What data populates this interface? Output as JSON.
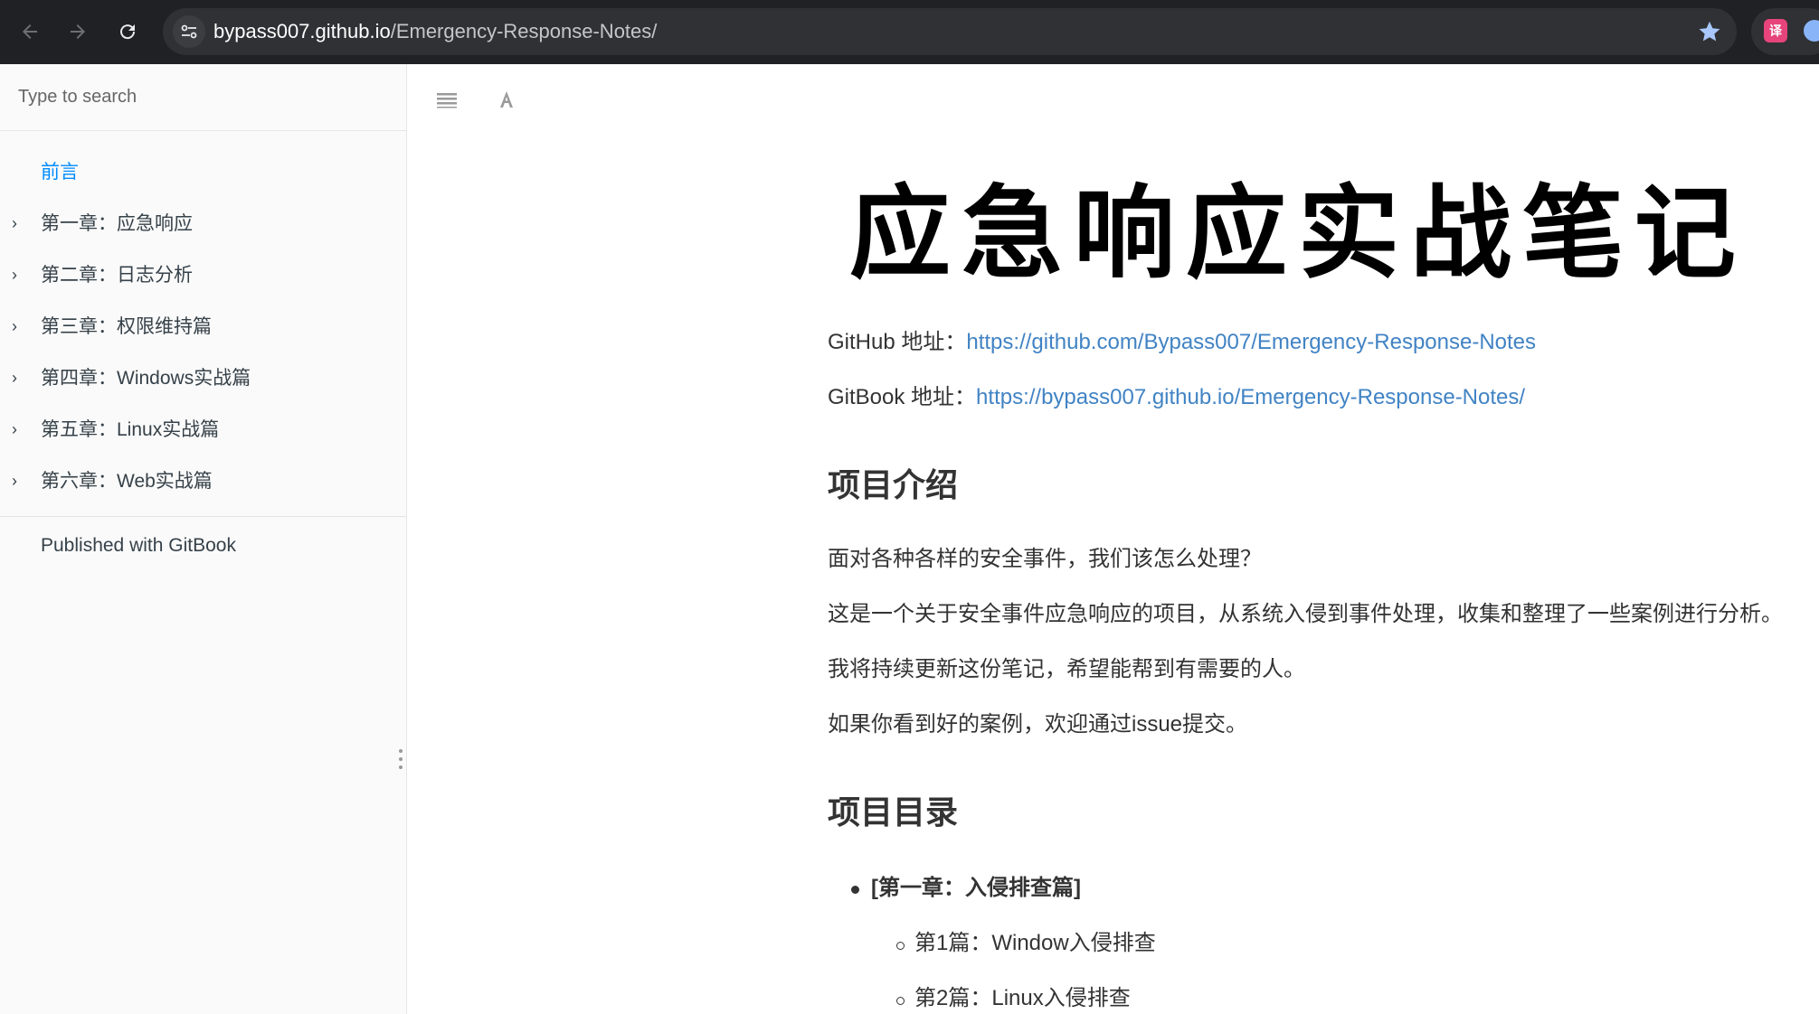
{
  "browser": {
    "url_host": "bypass007.github.io",
    "url_path": "/Emergency-Response-Notes/",
    "extension_label": "译"
  },
  "sidebar": {
    "search_placeholder": "Type to search",
    "items": [
      {
        "label": "前言",
        "expandable": false,
        "active": true
      },
      {
        "label": "第一章：应急响应",
        "expandable": true,
        "active": false
      },
      {
        "label": "第二章：日志分析",
        "expandable": true,
        "active": false
      },
      {
        "label": "第三章：权限维持篇",
        "expandable": true,
        "active": false
      },
      {
        "label": "第四章：Windows实战篇",
        "expandable": true,
        "active": false
      },
      {
        "label": "第五章：Linux实战篇",
        "expandable": true,
        "active": false
      },
      {
        "label": "第六章：Web实战篇",
        "expandable": true,
        "active": false
      }
    ],
    "published": "Published with GitBook"
  },
  "content": {
    "title_image_text": "应急响应实战笔记",
    "github_label": "GitHub 地址：",
    "github_url": "https://github.com/Bypass007/Emergency-Response-Notes",
    "gitbook_label": "GitBook 地址：",
    "gitbook_url": "https://bypass007.github.io/Emergency-Response-Notes/",
    "section1_heading": "项目介绍",
    "intro_paragraphs": [
      "面对各种各样的安全事件，我们该怎么处理？",
      "这是一个关于安全事件应急响应的项目，从系统入侵到事件处理，收集和整理了一些案例进行分析。",
      "我将持续更新这份笔记，希望能帮到有需要的人。",
      "如果你看到好的案例，欢迎通过issue提交。"
    ],
    "section2_heading": "项目目录",
    "toc_chapter": "[第一章：入侵排查篇]",
    "toc_items": [
      "第1篇：Window入侵排查",
      "第2篇：Linux入侵排查"
    ]
  },
  "colors": {
    "chrome_bg": "#202124",
    "omnibox_bg": "#303134",
    "link": "#4183c4",
    "sidebar_active": "#008cff",
    "sidebar_bg": "#fafafa"
  }
}
